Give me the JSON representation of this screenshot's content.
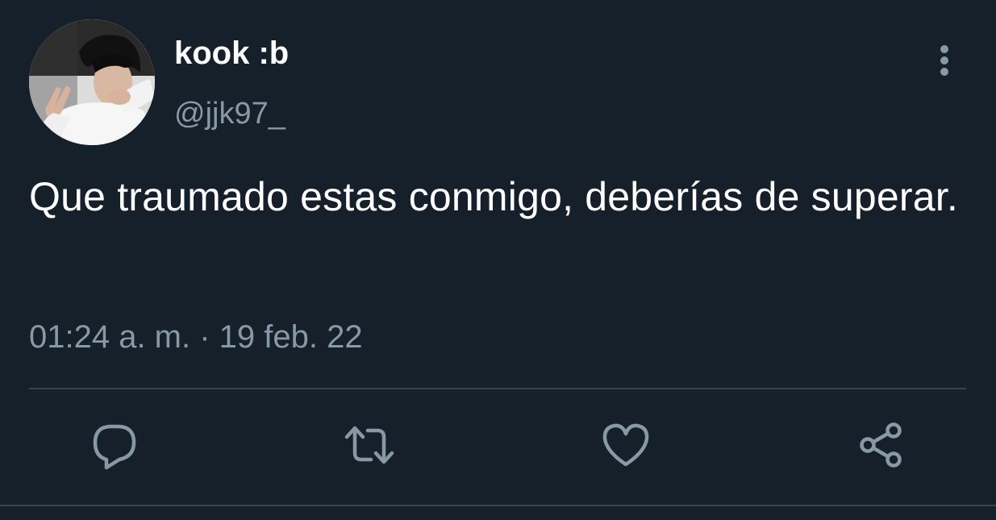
{
  "tweet": {
    "display_name": "kook :b",
    "handle": "@jjk97_",
    "text": "Que traumado estas conmigo, deberías de superar.",
    "timestamp": "01:24 a. m. · 19 feb. 22"
  },
  "icons": {
    "avatar": "profile-photo",
    "more": "more-vertical-icon",
    "reply": "reply-icon",
    "retweet": "retweet-icon",
    "like": "heart-icon",
    "share": "share-icon"
  },
  "colors": {
    "background": "#15202b",
    "primary_text": "#ffffff",
    "secondary_text": "#8899a6",
    "divider": "#38444d"
  }
}
